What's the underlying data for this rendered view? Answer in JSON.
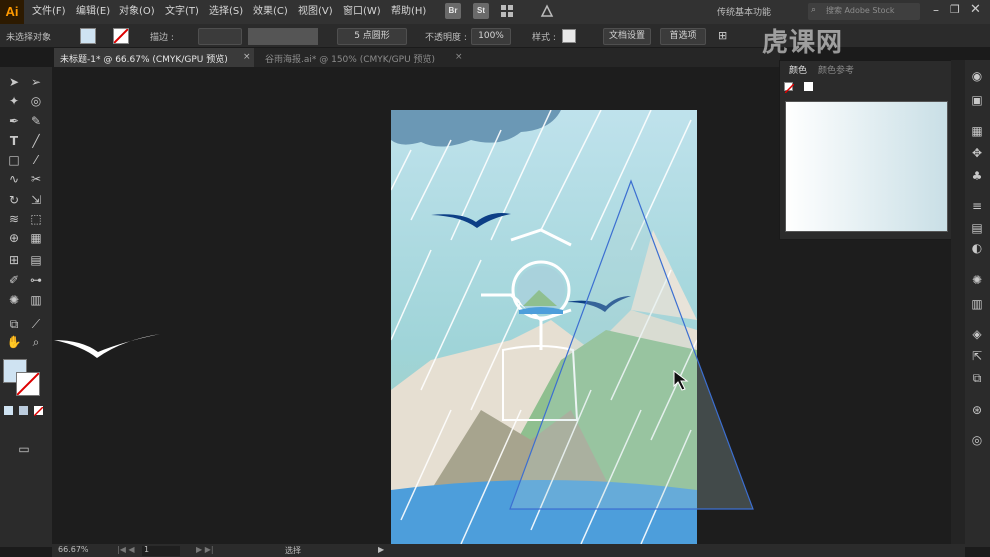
{
  "app": {
    "logo": "Ai",
    "workspace": "传统基本功能",
    "stock_search_placeholder": "搜索 Adobe Stock"
  },
  "menu": [
    "文件(F)",
    "编辑(E)",
    "对象(O)",
    "文字(T)",
    "选择(S)",
    "效果(C)",
    "视图(V)",
    "窗口(W)",
    "帮助(H)"
  ],
  "menu_badges": [
    "Br",
    "St"
  ],
  "control": {
    "selection_state": "未选择对象",
    "stroke_label": "描边 :",
    "brush_label": "5 点圆形",
    "opacity_label": "不透明度 :",
    "opacity_value": "100%",
    "style_label": "样式 :",
    "doc_setup": "文档设置",
    "preferences": "首选项"
  },
  "tabs": [
    {
      "label": "未标题-1* @ 66.67% (CMYK/GPU 预览)",
      "active": true
    },
    {
      "label": "谷雨海报.ai* @ 150% (CMYK/GPU 预览)",
      "active": false
    }
  ],
  "panels": {
    "color_tab": "颜色",
    "color_guide_tab": "颜色参考"
  },
  "status": {
    "zoom": "66.67%",
    "page": "1",
    "tool": "选择"
  },
  "watermark": "虎课网",
  "colors": {
    "sky_top": "#bfe2ec",
    "sea": "#4d9edb",
    "mountain_light": "#e8e3d9",
    "mountain_green": "#9cc79a",
    "bird": "#0d3f86",
    "accent": "#ff9a00"
  }
}
